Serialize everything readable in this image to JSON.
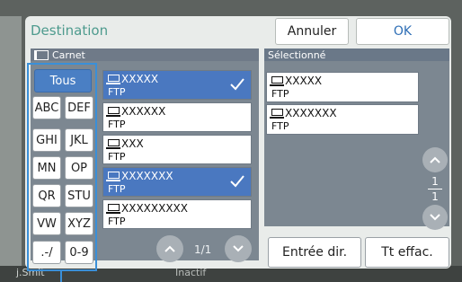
{
  "dialog": {
    "title": "Destination",
    "cancel_label": "Annuler",
    "ok_label": "OK"
  },
  "left_panel": {
    "header": "Carnet",
    "filters": [
      "Tous",
      "ABC",
      "DEF",
      "GHI",
      "JKL",
      "MN",
      "OP",
      "QR",
      "STU",
      "VW",
      "XYZ",
      ".-/",
      "0-9"
    ],
    "active_filter": "Tous",
    "entries": [
      {
        "name": "XXXXX",
        "protocol": "FTP",
        "selected": true
      },
      {
        "name": "XXXXXX",
        "protocol": "FTP",
        "selected": false
      },
      {
        "name": "XXX",
        "protocol": "FTP",
        "selected": false
      },
      {
        "name": "XXXXXXX",
        "protocol": "FTP",
        "selected": true
      },
      {
        "name": "XXXXXXXXX",
        "protocol": "FTP",
        "selected": false
      }
    ],
    "pager": "1/1"
  },
  "right_panel": {
    "header": "Sélectionné",
    "entries": [
      {
        "name": "XXXXX",
        "protocol": "FTP"
      },
      {
        "name": "XXXXXXX",
        "protocol": "FTP"
      }
    ],
    "page_current": "1",
    "page_total": "1"
  },
  "buttons": {
    "direct_entry": "Entrée dir.",
    "clear_all": "Tt effac."
  },
  "background": {
    "user": "j.Smit",
    "status": "Inactif"
  },
  "colors": {
    "accent_blue": "#4a78c0",
    "title_teal": "#4e9b8e",
    "focus_blue": "#3a8fd8"
  }
}
